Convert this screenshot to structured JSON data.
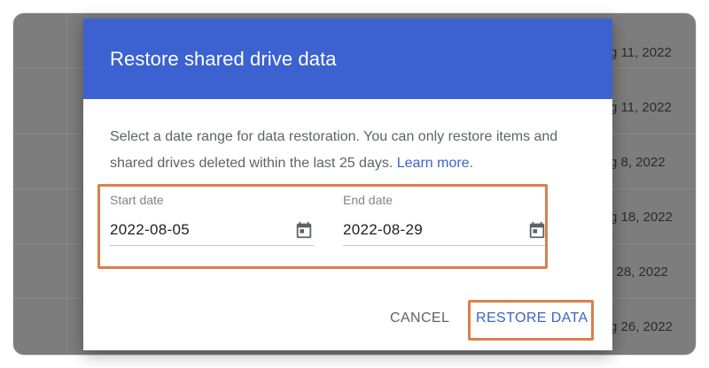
{
  "dialog": {
    "title": "Restore shared drive data",
    "description": "Select a date range for data restoration. You can only restore items and shared drives deleted within the last 25 days.",
    "learn_more": "Learn more",
    "learn_more_suffix": ".",
    "start_date": {
      "label": "Start date",
      "value": "2022-08-05"
    },
    "end_date": {
      "label": "End date",
      "value": "2022-08-29"
    },
    "cancel_label": "CANCEL",
    "restore_label": "RESTORE DATA"
  },
  "background": {
    "dates": [
      "g 11, 2022",
      "g 11, 2022",
      "g 8, 2022",
      "g 18, 2022",
      "l 28, 2022",
      "g 26, 2022"
    ]
  },
  "colors": {
    "header": "#3b62d0",
    "accent": "#3b62d0",
    "highlight": "#d9814a",
    "scrim": "#7d7d7d"
  },
  "icons": {
    "date_picker": "calendar-icon"
  }
}
